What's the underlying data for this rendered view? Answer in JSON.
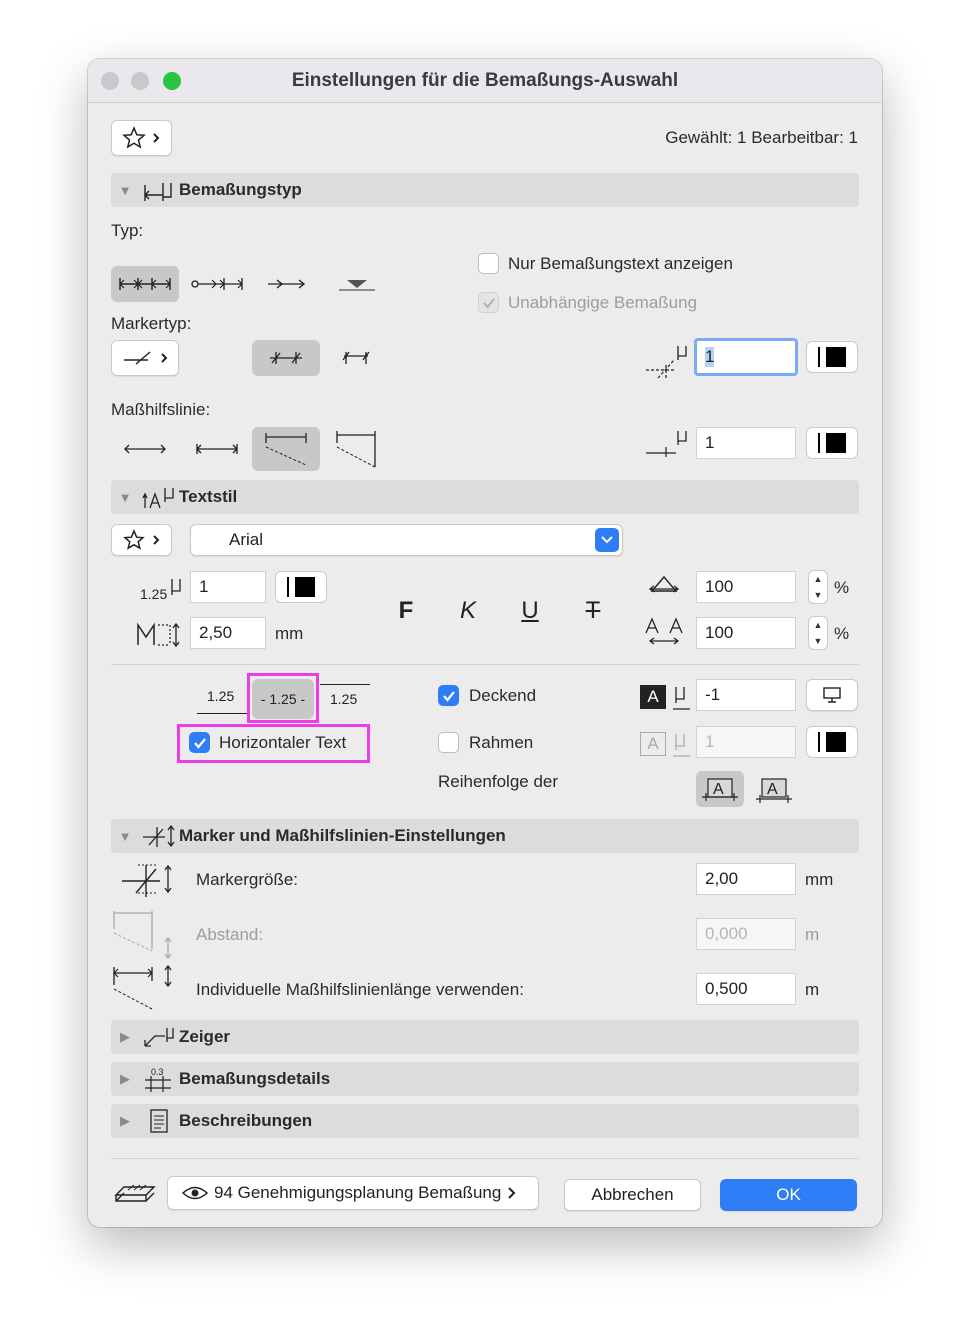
{
  "window": {
    "title": "Einstellungen für die Bemaßungs-Auswahl"
  },
  "header": {
    "selection_info": "Gewählt: 1 Bearbeitbar: 1"
  },
  "sections": {
    "type": "Bemaßungstyp",
    "textstyle": "Textstil",
    "markers": "Marker und Maßhilfslinien-Einstellungen",
    "pointer": "Zeiger",
    "details": "Bemaßungsdetails",
    "descriptions": "Beschreibungen"
  },
  "type_section": {
    "typ_label": "Typ:",
    "marker_label": "Markertyp:",
    "witness_label": "Maßhilfslinie:",
    "only_text_label": "Nur Bemaßungstext anzeigen",
    "only_text_checked": false,
    "independent_label": "Unabhängige Bemaßung",
    "independent_checked": true,
    "marker_pen": "1",
    "witness_pen": "1"
  },
  "text_section": {
    "font": "Arial",
    "text_pen": "1",
    "text_size": "2,50",
    "text_size_unit": "mm",
    "bold_label": "F",
    "italic_label": "K",
    "underline_label": "U",
    "strike_label": "T",
    "width_value": "100",
    "spacing_value": "100",
    "percent_unit": "%",
    "pos_sample": "1.25",
    "opaque_label": "Deckend",
    "opaque_checked": true,
    "frame_label": "Rahmen",
    "frame_checked": false,
    "horizontal_label": "Horizontaler Text",
    "horizontal_checked": true,
    "background_pen": "-1",
    "frame_pen": "1",
    "order_label": "Reihenfolge der",
    "icon_glyph": "A"
  },
  "marker_section": {
    "size_label": "Markergröße:",
    "size_value": "2,00",
    "size_unit": "mm",
    "distance_label": "Abstand:",
    "distance_value": "0,000",
    "distance_unit": "m",
    "length_label": "Individuelle Maßhilfslinienlänge verwenden:",
    "length_value": "0,500",
    "length_unit": "m"
  },
  "footer": {
    "layer": "94 Genehmigungsplanung Bemaßung",
    "cancel": "Abbrechen",
    "ok": "OK"
  },
  "colors": {
    "accent": "#2e7cf6",
    "highlight": "#ec3ee8",
    "close": "#c9c9c9",
    "minimize": "#c9c9c9",
    "maximize": "#29c441"
  },
  "icons": {
    "favorites": "star-icon",
    "chevron": "chevron-right-icon",
    "visibility": "eye-icon",
    "layers": "layers-icon"
  }
}
